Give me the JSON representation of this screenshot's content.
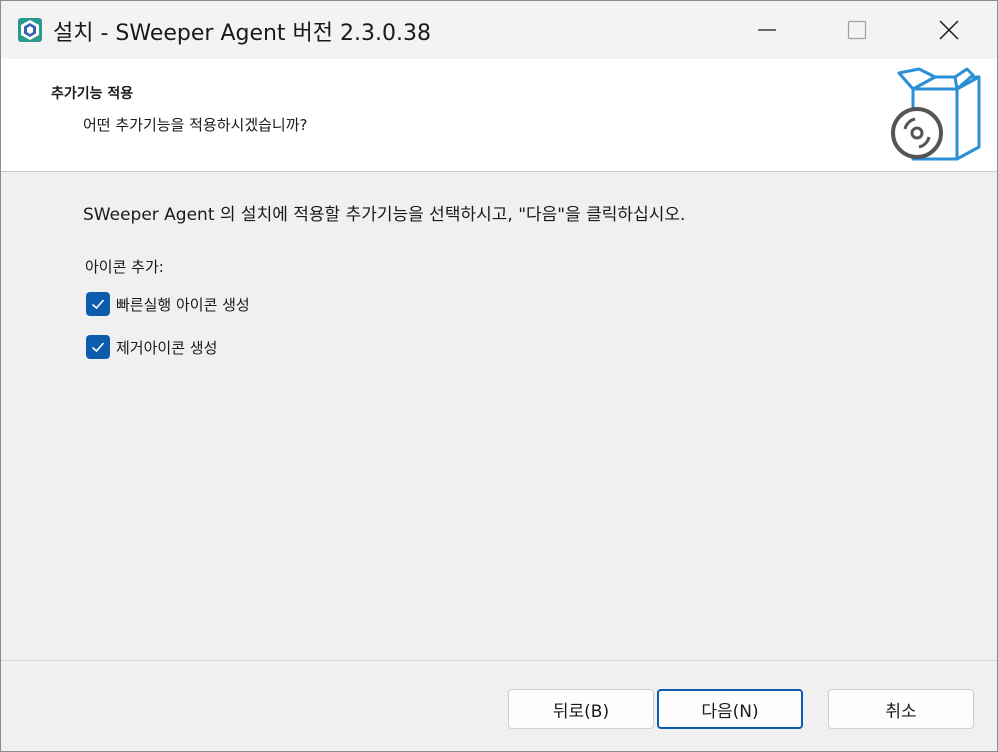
{
  "window": {
    "title": "설치 - SWeeper Agent 버전 2.3.0.38"
  },
  "header": {
    "title": "추가기능 적용",
    "subtitle": "어떤 추가기능을 적용하시겠습니까?"
  },
  "content": {
    "instruction": "SWeeper Agent 의 설치에 적용할 추가기능을 선택하시고, \"다음\"을 클릭하십시오.",
    "group_label": "아이콘 추가:",
    "options": [
      {
        "label": "빠른실행 아이콘 생성",
        "checked": true
      },
      {
        "label": "제거아이콘 생성",
        "checked": true
      }
    ]
  },
  "buttons": {
    "back": "뒤로(B)",
    "next": "다음(N)",
    "cancel": "취소"
  },
  "colors": {
    "accent": "#0b5cad",
    "icon_blue": "#2a8fd6"
  },
  "icons": [
    "app-icon",
    "minimize-icon",
    "maximize-icon",
    "close-icon",
    "software-box-icon",
    "check-icon"
  ]
}
